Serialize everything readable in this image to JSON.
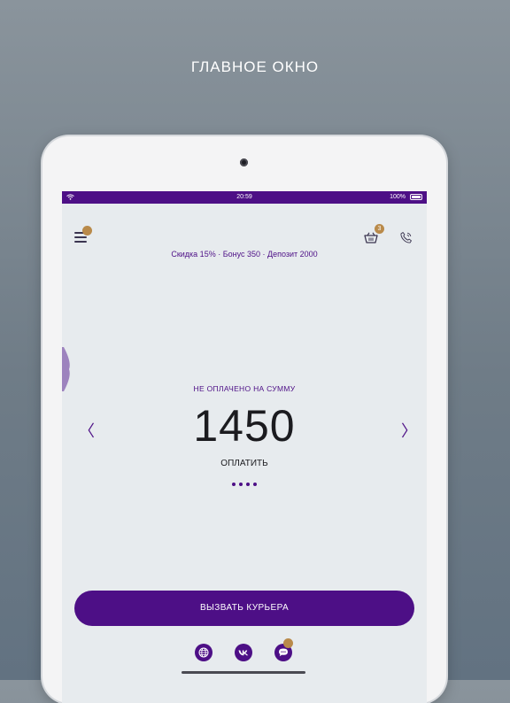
{
  "promo": {
    "title": "ГЛАВНОЕ ОКНО"
  },
  "status_bar": {
    "time": "20:59",
    "battery": "100%"
  },
  "header": {
    "menu_badge": "",
    "basket_badge": "3",
    "account_info": "Скидка 15% · Бонус 350 · Депозит 2000"
  },
  "main": {
    "unpaid_label": "НЕ ОПЛАЧЕНО НА СУММУ",
    "amount": "1450",
    "pay_label": "ОПЛАТИТЬ",
    "carousel_prev": "〈",
    "carousel_next": "〉",
    "page_dots": 4
  },
  "footer": {
    "courier_button": "ВЫЗВАТЬ КУРЬЕРА",
    "social": [
      {
        "icon": "globe-icon"
      },
      {
        "icon": "vk-icon"
      },
      {
        "icon": "chat-icon"
      }
    ],
    "chat_badge": ""
  },
  "colors": {
    "brand": "#4d0f86",
    "badge": "#b98a4a",
    "screen_bg": "#e7ebee"
  }
}
